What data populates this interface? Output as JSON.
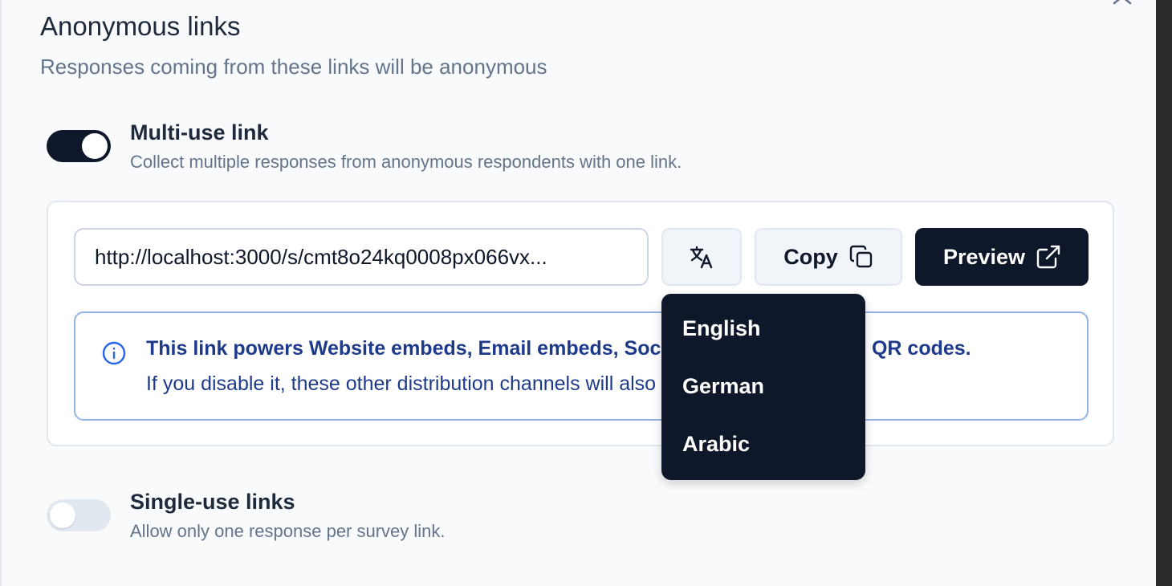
{
  "header": {
    "title": "Anonymous links",
    "subtitle": "Responses coming from these links will be anonymous"
  },
  "multi_use": {
    "title": "Multi-use link",
    "description": "Collect multiple responses from anonymous respondents with one link.",
    "enabled": true,
    "url": "http://localhost:3000/s/cmt8o24kq0008px066vx...",
    "copy_label": "Copy",
    "preview_label": "Preview",
    "info_line1": "This link powers Website embeds, Email embeds, Social media sharing and QR codes.",
    "info_line2": "If you disable it, these other distribution channels will also be disabled."
  },
  "language_menu": {
    "items": [
      "English",
      "German",
      "Arabic"
    ]
  },
  "single_use": {
    "title": "Single-use links",
    "description": "Allow only one response per survey link.",
    "enabled": false
  },
  "icons": {
    "close": "close-icon",
    "language": "language-icon",
    "copy": "copy-icon",
    "external": "external-link-icon",
    "info": "info-icon"
  },
  "colors": {
    "primary": "#0f172a",
    "info_text": "#1e3a8a",
    "info_border": "#93b4e8"
  }
}
